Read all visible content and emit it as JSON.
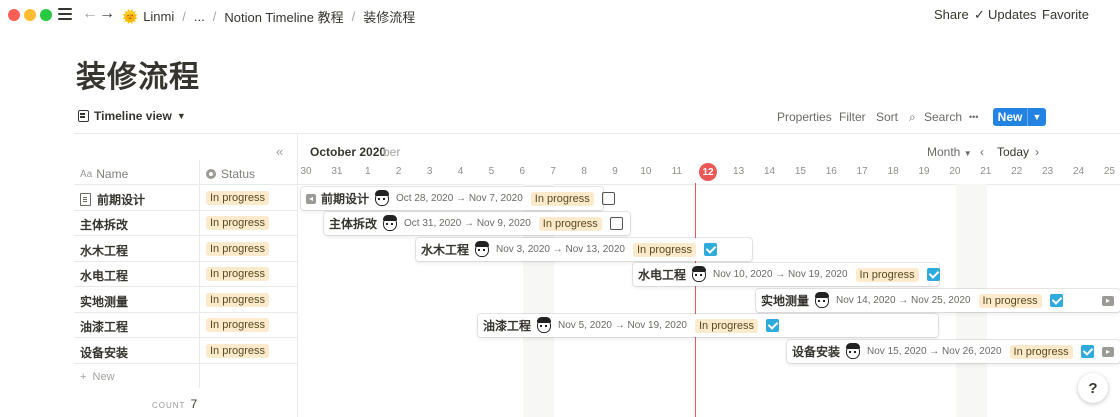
{
  "breadcrumb": {
    "workspace": "Linmi",
    "ellipsis": "...",
    "parent": "Notion Timeline 教程",
    "current": "装修流程"
  },
  "topbar": {
    "share": "Share",
    "updates": "Updates",
    "favorite": "Favorite"
  },
  "page": {
    "title": "装修流程"
  },
  "view": {
    "name": "Timeline view",
    "properties": "Properties",
    "filter": "Filter",
    "sort": "Sort",
    "search": "Search",
    "more": "•••",
    "new": "New"
  },
  "table": {
    "name_header": "Name",
    "status_header": "Status",
    "rows": [
      {
        "name": "前期设计",
        "status": "In progress"
      },
      {
        "name": "主体拆改",
        "status": "In progress"
      },
      {
        "name": "水木工程",
        "status": "In progress"
      },
      {
        "name": "水电工程",
        "status": "In progress"
      },
      {
        "name": "实地测量",
        "status": "In progress"
      },
      {
        "name": "油漆工程",
        "status": "In progress"
      },
      {
        "name": "设备安装",
        "status": "In progress"
      }
    ],
    "new_label": "New",
    "count_label": "COUNT",
    "count_value": "7"
  },
  "timeline": {
    "month_label": "October 2020",
    "next_month_fragment": "ber",
    "scale": "Month",
    "today_label": "Today",
    "today_day": "12",
    "days": [
      "30",
      "31",
      "1",
      "2",
      "3",
      "4",
      "5",
      "6",
      "7",
      "8",
      "9",
      "10",
      "11",
      "12",
      "13",
      "14",
      "15",
      "16",
      "17",
      "18",
      "19",
      "20",
      "21",
      "22",
      "23",
      "24",
      "25"
    ],
    "bars": [
      {
        "name": "前期设计",
        "dates": "Oct 28, 2020 → Nov 7, 2020",
        "status": "In progress",
        "checked": false
      },
      {
        "name": "主体拆改",
        "dates": "Oct 31, 2020 → Nov 9, 2020",
        "status": "In progress",
        "checked": false
      },
      {
        "name": "水木工程",
        "dates": "Nov 3, 2020 → Nov 13, 2020",
        "status": "In progress",
        "checked": true
      },
      {
        "name": "水电工程",
        "dates": "Nov 10, 2020 → Nov 19, 2020",
        "status": "In progress",
        "checked": true
      },
      {
        "name": "实地测量",
        "dates": "Nov 14, 2020 → Nov 25, 2020",
        "status": "In progress",
        "checked": true
      },
      {
        "name": "油漆工程",
        "dates": "Nov 5, 2020 → Nov 19, 2020",
        "status": "In progress",
        "checked": true
      },
      {
        "name": "设备安装",
        "dates": "Nov 15, 2020 → Nov 26, 2020",
        "status": "In progress",
        "checked": true
      }
    ]
  },
  "help": "?"
}
